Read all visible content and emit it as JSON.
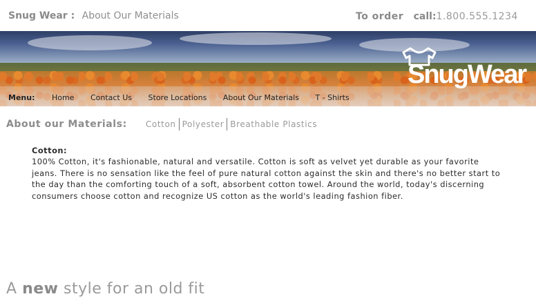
{
  "header": {
    "brand": "Snug Wear :",
    "subtitle": "About Our Materials",
    "order_label": "To order",
    "call_label": "call:",
    "phone": "1.800.555.1234"
  },
  "logo": {
    "text": "SnugWear",
    "icon": "t-shirt-icon"
  },
  "menu": {
    "label": "Menu:",
    "items": [
      "Home",
      "Contact Us",
      "Store Locations",
      "About Our Materials",
      "T - Shirts"
    ]
  },
  "materials_nav": {
    "heading": "About our Materials:",
    "links": [
      "Cotton",
      "Polyester",
      "Breathable Plastics"
    ]
  },
  "content": {
    "title": "Cotton:",
    "body": "100% Cotton, it's fashionable, natural and versatile. Cotton is soft as velvet yet durable as your favorite jeans. There is no sensation like the feel of pure natural cotton against the skin and there's no better start to the day than the comforting touch of a soft, absorbent cotton towel. Around the world, today's discerning consumers choose cotton and recognize US cotton as the world's leading fashion fiber."
  },
  "tagline": {
    "prefix": "A",
    "emphasis": "new",
    "suffix": "style for an old fit"
  },
  "colors": {
    "text_gray": "#8a8a8a",
    "menu_band": "#e2c3ad",
    "sky": "#3a4c78"
  }
}
